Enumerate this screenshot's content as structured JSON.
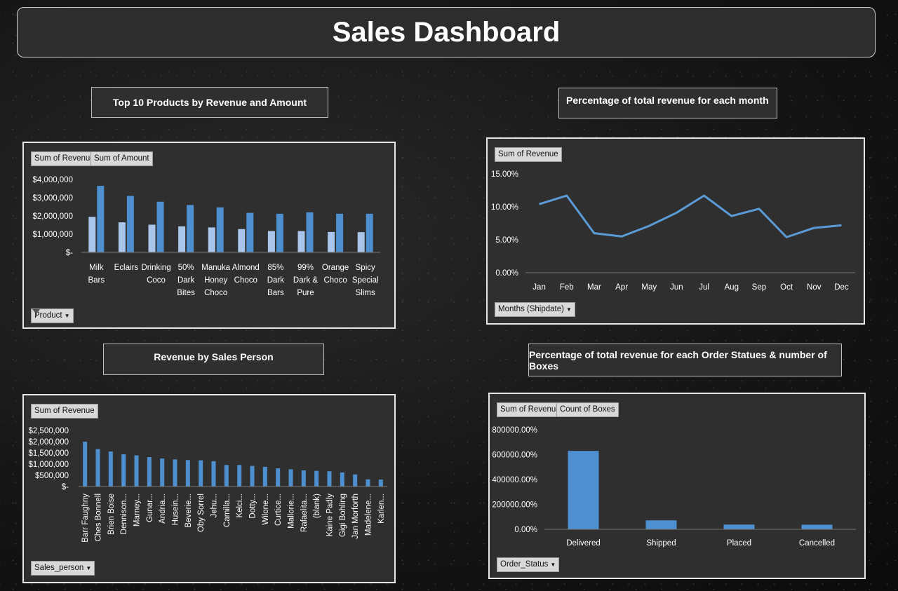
{
  "title": "Sales Dashboard",
  "colors": {
    "primary": "#4e8fd0",
    "secondary": "#a9c6ea",
    "panel": "#2f2f2f"
  },
  "panels": {
    "top_products": {
      "label": "Top 10 Products by Revenue and Amount",
      "field_buttons": [
        "Sum of Revenue",
        "Sum of Amount"
      ],
      "filter_button": "Product",
      "filter_icon": "funnel-icon"
    },
    "monthly": {
      "label": "Percentage of total revenue for each month",
      "field_buttons": [
        "Sum of Revenue"
      ],
      "filter_button": "Months (Shipdate)"
    },
    "sales_person": {
      "label": "Revenue by Sales Person",
      "field_buttons": [
        "Sum of Revenue"
      ],
      "filter_button": "Sales_person"
    },
    "order_status": {
      "label": "Percentage of total revenue for each  Order Statues & number of Boxes",
      "field_buttons": [
        "Sum of Revenue",
        "Count of Boxes"
      ],
      "filter_button": "Order_Status"
    }
  },
  "chart_data": [
    {
      "id": "top_products",
      "type": "bar",
      "categories": [
        [
          "Milk",
          "Bars"
        ],
        [
          "Eclairs"
        ],
        [
          "Drinking",
          "Coco"
        ],
        [
          "50%",
          "Dark",
          "Bites"
        ],
        [
          "Manuka",
          "Honey",
          "Choco"
        ],
        [
          "Almond",
          "Choco"
        ],
        [
          "85%",
          "Dark",
          "Bars"
        ],
        [
          "99%",
          "Dark &",
          "Pure"
        ],
        [
          "Orange",
          "Choco"
        ],
        [
          "Spicy",
          "Special",
          "Slims"
        ]
      ],
      "series": [
        {
          "name": "Sum of Revenue",
          "values": [
            1950000,
            1650000,
            1520000,
            1430000,
            1370000,
            1280000,
            1170000,
            1170000,
            1120000,
            1110000
          ]
        },
        {
          "name": "Sum of Amount",
          "values": [
            3650000,
            3100000,
            2780000,
            2600000,
            2470000,
            2170000,
            2120000,
            2200000,
            2120000,
            2120000
          ]
        }
      ],
      "yticks": [
        "$-",
        "$1,000,000",
        "$2,000,000",
        "$3,000,000",
        "$4,000,000"
      ],
      "ylim": [
        0,
        4000000
      ]
    },
    {
      "id": "monthly",
      "type": "line",
      "categories": [
        "Jan",
        "Feb",
        "Mar",
        "Apr",
        "May",
        "Jun",
        "Jul",
        "Aug",
        "Sep",
        "Oct",
        "Nov",
        "Dec"
      ],
      "series": [
        {
          "name": "Sum of Revenue",
          "values": [
            10.4,
            11.7,
            6.0,
            5.5,
            7.1,
            9.1,
            11.7,
            8.6,
            9.7,
            5.4,
            6.8,
            7.2
          ]
        }
      ],
      "yticks": [
        "0.00%",
        "5.00%",
        "10.00%",
        "15.00%"
      ],
      "ylim": [
        0,
        15
      ]
    },
    {
      "id": "sales_person",
      "type": "bar",
      "categories": [
        "Barr Faughny",
        "Ches Bonnell",
        "Brien Boise",
        "Dennison...",
        "Marney...",
        "Gunar...",
        "Andria...",
        "Husein...",
        "Beverie...",
        "Oby Sorrel",
        "Jehu...",
        "Camilla...",
        "Kelci...",
        "Dotty...",
        "Wilone...",
        "Curtice...",
        "Mallorie...",
        "Rafaelita...",
        "(blank)",
        "Kaine Padly",
        "Gigi Bohling",
        "Jan Morforth",
        "Madelene...",
        "Karlen..."
      ],
      "series": [
        {
          "name": "Sum of Revenue",
          "values": [
            2000000,
            1670000,
            1560000,
            1440000,
            1390000,
            1310000,
            1250000,
            1210000,
            1180000,
            1170000,
            1130000,
            960000,
            960000,
            920000,
            880000,
            810000,
            770000,
            720000,
            700000,
            680000,
            630000,
            540000,
            320000,
            310000
          ]
        }
      ],
      "yticks": [
        "$-",
        "$500,000",
        "$1,000,000",
        "$1,500,000",
        "$2,000,000",
        "$2,500,000"
      ],
      "ylim": [
        0,
        2500000
      ]
    },
    {
      "id": "order_status",
      "type": "bar",
      "categories": [
        "Delivered",
        "Shipped",
        "Placed",
        "Cancelled"
      ],
      "series": [
        {
          "name": "Sum of Revenue",
          "values": [
            630000,
            72000,
            38000,
            37000
          ]
        }
      ],
      "yticks": [
        "0.00%",
        "200000.00%",
        "400000.00%",
        "600000.00%",
        "800000.00%"
      ],
      "ylim": [
        0,
        800000
      ]
    }
  ]
}
